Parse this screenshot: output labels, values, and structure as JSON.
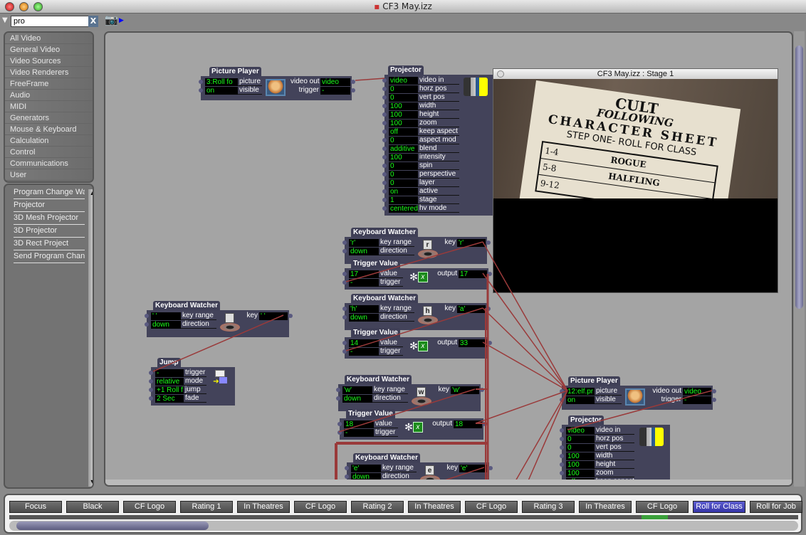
{
  "window": {
    "title": "CF3 May.izz"
  },
  "search": {
    "value": "pro",
    "clear_label": "X"
  },
  "categories": [
    "All Video",
    "General Video",
    "Video Sources",
    "Video Renderers",
    "FreeFrame",
    "Audio",
    "MIDI",
    "Generators",
    "Mouse & Keyboard",
    "Calculation",
    "Control",
    "Communications",
    "User"
  ],
  "results": [
    "Program Change Wa",
    "Projector",
    "3D Mesh Projector",
    "3D Projector",
    "3D Rect Project",
    "Send Program Chang"
  ],
  "stage": {
    "title": "CF3 May.izz : Stage 1",
    "image_text": [
      "CULT",
      "FOLLOWING",
      "CHARACTER SHEET",
      "STEP ONE- ROLL FOR CLASS",
      "1-4",
      "ROGUE",
      "5-8",
      "HALFLING",
      "9-12"
    ]
  },
  "actors": [
    {
      "title": "Picture Player",
      "icon": "picture-icon",
      "inputs": [
        {
          "value": "3:Roll fo",
          "label": "picture"
        },
        {
          "value": "on",
          "label": "visible"
        }
      ],
      "outputs": [
        {
          "label": "video out",
          "value": "video"
        },
        {
          "label": "trigger",
          "value": "-"
        }
      ]
    },
    {
      "title": "Projector",
      "icon": "projector-icon",
      "inputs": [
        {
          "value": "video",
          "label": "video in"
        },
        {
          "value": "0",
          "label": "horz pos"
        },
        {
          "value": "0",
          "label": "vert pos"
        },
        {
          "value": "100",
          "label": "width"
        },
        {
          "value": "100",
          "label": "height"
        },
        {
          "value": "100",
          "label": "zoom"
        },
        {
          "value": "off",
          "label": "keep aspect"
        },
        {
          "value": "0",
          "label": "aspect mod"
        },
        {
          "value": "additive",
          "label": "blend"
        },
        {
          "value": "100",
          "label": "intensity"
        },
        {
          "value": "0",
          "label": "spin"
        },
        {
          "value": "0",
          "label": "perspective"
        },
        {
          "value": "0",
          "label": "layer"
        },
        {
          "value": "on",
          "label": "active"
        },
        {
          "value": "1",
          "label": "stage"
        },
        {
          "value": "centered",
          "label": "hv mode"
        }
      ],
      "outputs": []
    },
    {
      "title": "Keyboard Watcher",
      "icon": "eye-icon",
      "key": "r",
      "inputs": [
        {
          "value": "'r'",
          "label": "key range"
        },
        {
          "value": "down",
          "label": "direction"
        }
      ],
      "outputs": [
        {
          "label": "key",
          "value": "'r'"
        }
      ]
    },
    {
      "title": "Trigger Value",
      "icon": "trigger-icon",
      "inputs": [
        {
          "value": "17",
          "label": "value"
        },
        {
          "value": "-",
          "label": "trigger"
        }
      ],
      "outputs": [
        {
          "label": "output",
          "value": "17"
        }
      ]
    },
    {
      "title": "Keyboard Watcher",
      "icon": "eye-icon",
      "key": "h",
      "inputs": [
        {
          "value": "'h'",
          "label": "key range"
        },
        {
          "value": "down",
          "label": "direction"
        }
      ],
      "outputs": [
        {
          "label": "key",
          "value": "'a'"
        }
      ]
    },
    {
      "title": "Trigger Value",
      "icon": "trigger-icon",
      "inputs": [
        {
          "value": "14",
          "label": "value"
        },
        {
          "value": "-",
          "label": "trigger"
        }
      ],
      "outputs": [
        {
          "label": "output",
          "value": "33"
        }
      ]
    },
    {
      "title": "Keyboard Watcher",
      "icon": "eye-icon",
      "key": "w",
      "inputs": [
        {
          "value": "'w'",
          "label": "key range"
        },
        {
          "value": "down",
          "label": "direction"
        }
      ],
      "outputs": [
        {
          "label": "key",
          "value": "'w'"
        }
      ]
    },
    {
      "title": "Trigger Value",
      "icon": "trigger-icon",
      "inputs": [
        {
          "value": "18",
          "label": "value"
        },
        {
          "value": "-",
          "label": "trigger"
        }
      ],
      "outputs": [
        {
          "label": "output",
          "value": "18"
        }
      ]
    },
    {
      "title": "Keyboard Watcher",
      "icon": "eye-icon",
      "key": "e",
      "inputs": [
        {
          "value": "'e'",
          "label": "key range"
        },
        {
          "value": "down",
          "label": "direction"
        }
      ],
      "outputs": [
        {
          "label": "key",
          "value": "'e'"
        }
      ]
    },
    {
      "title": "Keyboard Watcher",
      "icon": "eye-icon",
      "key": "",
      "inputs": [
        {
          "value": "' '",
          "label": "key range"
        },
        {
          "value": "down",
          "label": "direction"
        }
      ],
      "outputs": [
        {
          "label": "key",
          "value": "' '"
        }
      ]
    },
    {
      "title": "Jump",
      "icon": "jump-icon",
      "inputs": [
        {
          "value": "-",
          "label": "trigger"
        },
        {
          "value": "relative",
          "label": "mode"
        },
        {
          "value": "+1 Roll f",
          "label": "jump"
        },
        {
          "value": "2 Sec",
          "label": "fade"
        }
      ],
      "outputs": []
    },
    {
      "title": "Picture Player",
      "icon": "picture-icon",
      "inputs": [
        {
          "value": "12:elf.pr",
          "label": "picture"
        },
        {
          "value": "on",
          "label": "visible"
        }
      ],
      "outputs": [
        {
          "label": "video out",
          "value": "video"
        },
        {
          "label": "trigger",
          "value": "-"
        }
      ]
    },
    {
      "title": "Projector",
      "icon": "projector-icon",
      "inputs": [
        {
          "value": "video",
          "label": "video in"
        },
        {
          "value": "0",
          "label": "horz pos"
        },
        {
          "value": "0",
          "label": "vert pos"
        },
        {
          "value": "100",
          "label": "width"
        },
        {
          "value": "100",
          "label": "height"
        },
        {
          "value": "100",
          "label": "zoom"
        },
        {
          "value": "off",
          "label": "keep aspect"
        }
      ],
      "outputs": []
    }
  ],
  "scenes": [
    {
      "label": "Focus"
    },
    {
      "label": "Black"
    },
    {
      "label": "CF Logo"
    },
    {
      "label": "Rating 1"
    },
    {
      "label": "In Theatres"
    },
    {
      "label": "CF Logo"
    },
    {
      "label": "Rating 2"
    },
    {
      "label": "In Theatres"
    },
    {
      "label": "CF Logo"
    },
    {
      "label": "Rating 3"
    },
    {
      "label": "In Theatres"
    },
    {
      "label": "CF Logo"
    },
    {
      "label": "Roll for Class",
      "active": true
    },
    {
      "label": "Roll for Job"
    }
  ],
  "colors": {
    "cable": "#9a3a3a",
    "value_text": "#19ff19",
    "active_scene": "#4545c0",
    "progress": "#3aa03a"
  }
}
